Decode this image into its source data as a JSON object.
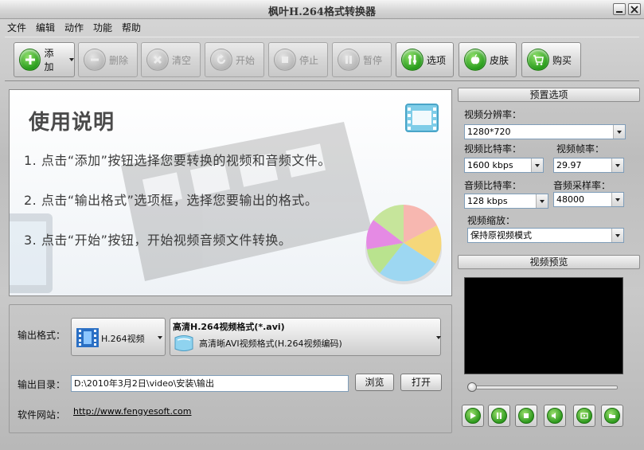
{
  "window": {
    "title": "枫叶H.264格式转换器",
    "buttons": {
      "minimize": "minimize",
      "close": "close"
    }
  },
  "menu": [
    "文件",
    "编辑",
    "动作",
    "功能",
    "帮助"
  ],
  "toolbar": {
    "add": "添加",
    "delete": "删除",
    "clear": "清空",
    "start": "开始",
    "stop": "停止",
    "pause": "暂停",
    "options": "选项",
    "skin": "皮肤",
    "buy": "购买"
  },
  "instructions": {
    "title": "使用说明",
    "steps": [
      "1. 点击“添加”按钮选择您要转换的视频和音频文件。",
      "2. 点击“输出格式”选项框，选择您要输出的格式。",
      "3. 点击“开始”按钮，开始视频音频文件转换。"
    ]
  },
  "preset": {
    "header": "预置选项",
    "resolution_label": "视频分辨率：",
    "resolution_value": "1280*720",
    "video_bitrate_label": "视频比特率：",
    "video_bitrate_value": "1600 kbps",
    "frame_rate_label": "视频帧率：",
    "frame_rate_value": "29.97",
    "audio_bitrate_label": "音频比特率：",
    "audio_bitrate_value": "128 kbps",
    "sample_rate_label": "音频采样率：",
    "sample_rate_value": "48000",
    "zoom_label": "视频缩放：",
    "zoom_value": "保持原视频模式"
  },
  "preview": {
    "header": "视频预览",
    "seek_position": 0
  },
  "output": {
    "format_label": "输出格式：",
    "format_button": "H.264视频",
    "format_title": "高清H.264视频格式(*.avi)",
    "format_desc": "高清晰AVI视频格式(H.264视频编码)",
    "dir_label": "输出目录：",
    "dir_value": "D:\\2010年3月2日\\video\\安装\\输出",
    "browse": "浏览",
    "open": "打开",
    "website_label": "软件网站：",
    "website_url": "http://www.fengyesoft.com"
  },
  "colors": {
    "accent_green": "#2e9a1e",
    "video_bg": "#000000"
  }
}
